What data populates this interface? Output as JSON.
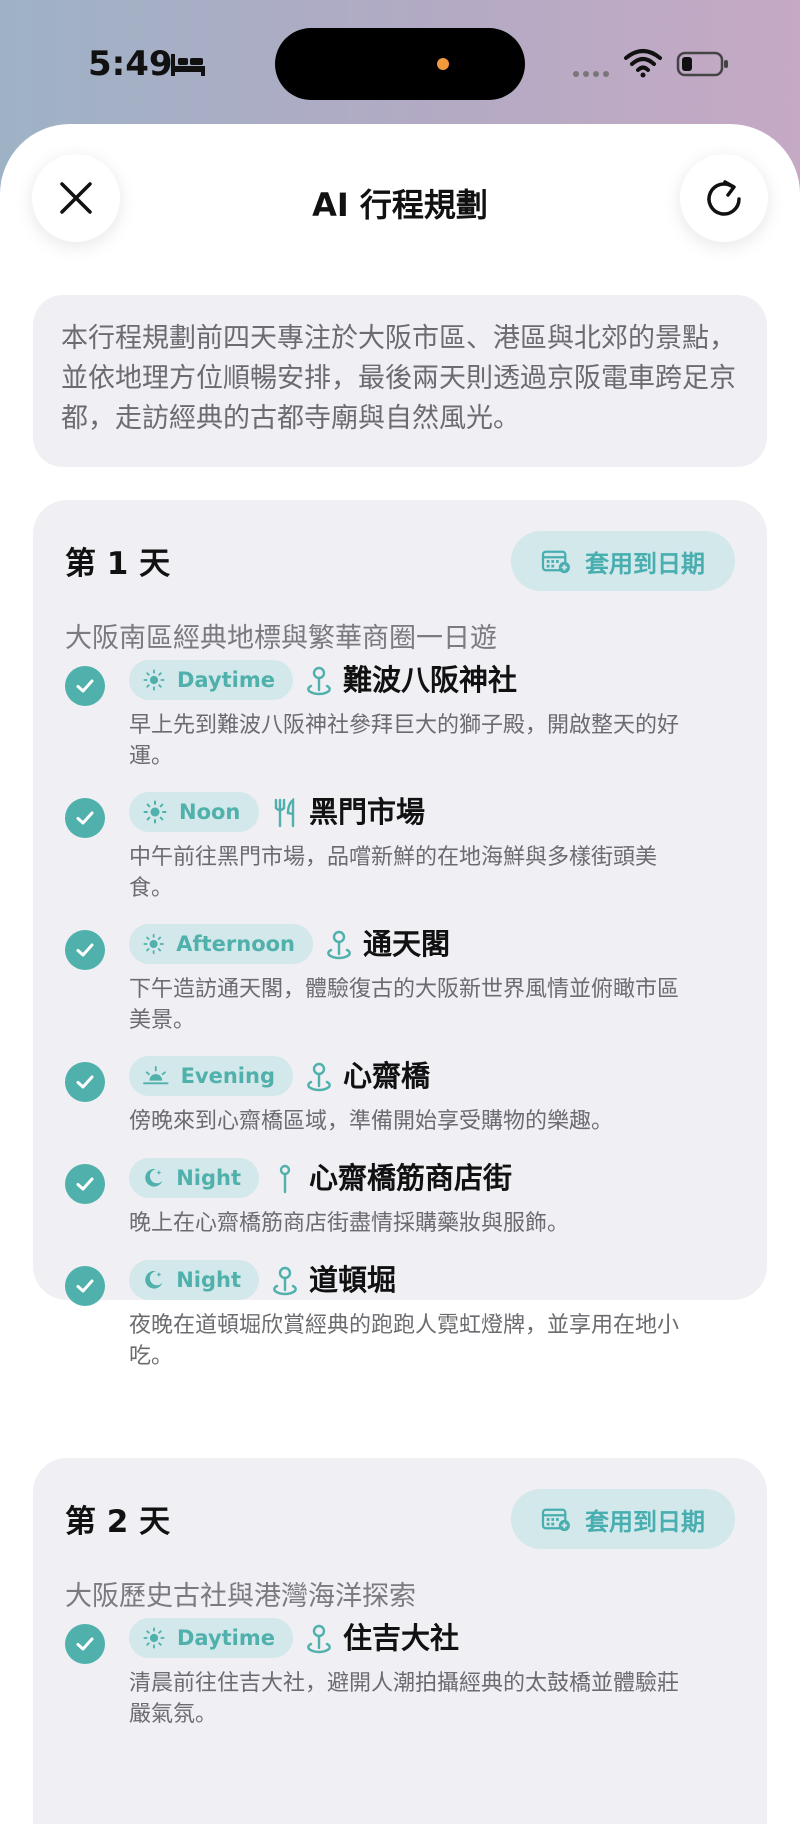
{
  "status_bar": {
    "time": "5:49",
    "icons": [
      "bed-icon",
      "cellular-dots-icon",
      "wifi-icon",
      "battery-icon"
    ]
  },
  "header": {
    "title": "AI 行程規劃",
    "left_icon": "close-icon",
    "right_icon": "refresh-icon"
  },
  "summary": "本行程規劃前四天專注於大阪市區、港區與北郊的景點，並依地理方位順暢安排，最後兩天則透過京阪電車跨足京都，走訪經典的古都寺廟與自然風光。",
  "colors": {
    "accent": "#4fb0ac",
    "pill_bg": "#d3e8ea",
    "card_bg": "#efeff4",
    "text_secondary": "#6b6b70"
  },
  "days": [
    {
      "title": "第 1 天",
      "apply_label": "套用到日期",
      "subtitle": "大阪南區經典地標與繁華商圈一日遊",
      "activities": [
        {
          "time": "Daytime",
          "time_icon": "sun-icon",
          "place_icon": "map-pin-icon",
          "name": "難波八阪神社",
          "desc": "早上先到難波八阪神社參拜巨大的獅子殿，開啟整天的好運。"
        },
        {
          "time": "Noon",
          "time_icon": "sun-icon",
          "place_icon": "fork-knife-icon",
          "name": "黑門市場",
          "desc": "中午前往黑門市場，品嚐新鮮的在地海鮮與多樣街頭美食。"
        },
        {
          "time": "Afternoon",
          "time_icon": "sun-icon",
          "place_icon": "map-pin-icon",
          "name": "通天閣",
          "desc": "下午造訪通天閣，體驗復古的大阪新世界風情並俯瞰市區美景。"
        },
        {
          "time": "Evening",
          "time_icon": "sunset-icon",
          "place_icon": "map-pin-icon",
          "name": "心齋橋",
          "desc": "傍晚來到心齋橋區域，準備開始享受購物的樂趣。"
        },
        {
          "time": "Night",
          "time_icon": "moon-icon",
          "place_icon": "pin-icon",
          "name": "心齋橋筋商店街",
          "desc": "晚上在心齋橋筋商店街盡情採購藥妝與服飾。"
        },
        {
          "time": "Night",
          "time_icon": "moon-icon",
          "place_icon": "map-pin-icon",
          "name": "道頓堀",
          "desc": "夜晚在道頓堀欣賞經典的跑跑人霓虹燈牌，並享用在地小吃。"
        }
      ]
    },
    {
      "title": "第 2 天",
      "apply_label": "套用到日期",
      "subtitle": "大阪歷史古社與港灣海洋探索",
      "activities": [
        {
          "time": "Daytime",
          "time_icon": "sun-icon",
          "place_icon": "map-pin-icon",
          "name": "住吉大社",
          "desc": "清晨前往住吉大社，避開人潮拍攝經典的太鼓橋並體驗莊嚴氣氛。"
        }
      ]
    }
  ]
}
